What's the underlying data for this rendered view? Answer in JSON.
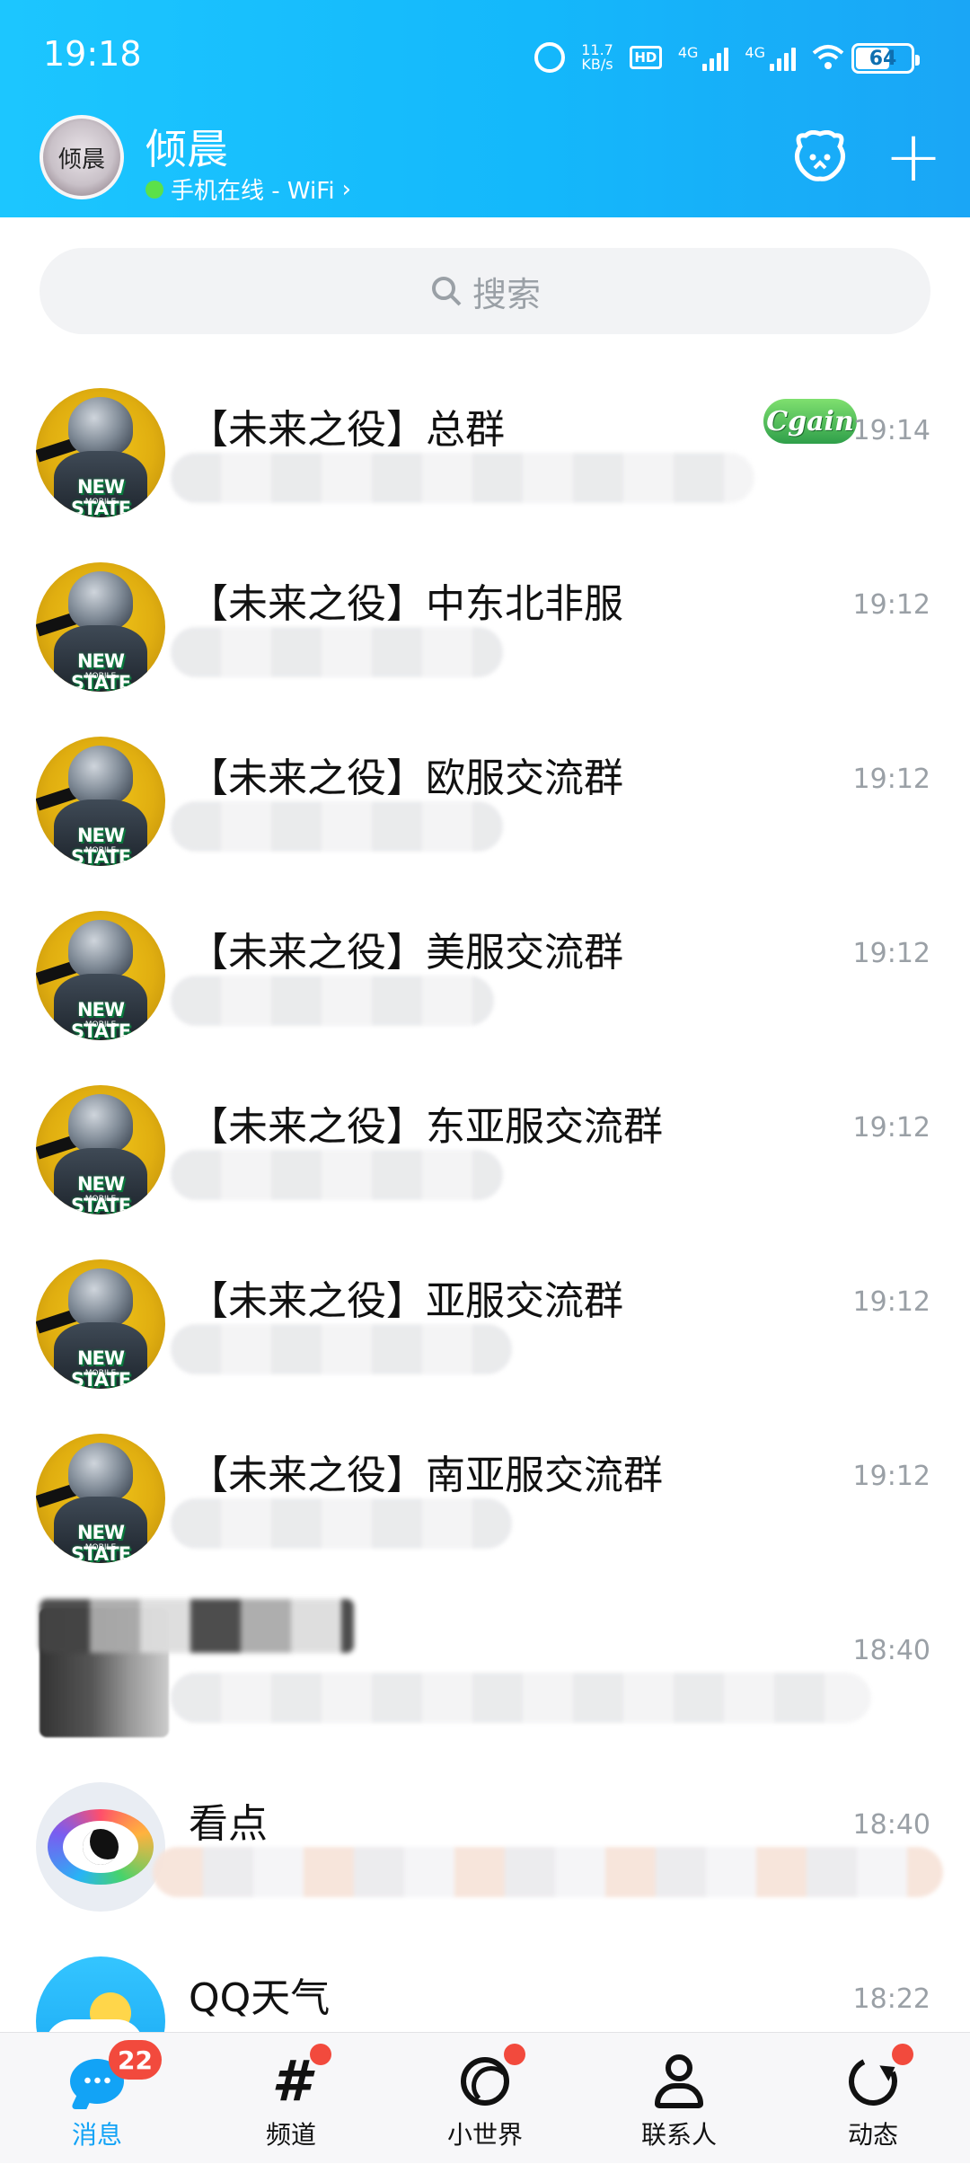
{
  "status_bar": {
    "time": "19:18",
    "net_speed_value": "11.7",
    "net_speed_unit": "KB/s",
    "hd_label": "HD",
    "signal1_label": "4G",
    "signal2_label": "4G",
    "battery": "64"
  },
  "header": {
    "avatar_text": "倾晨",
    "nickname": "倾晨",
    "online_status": "手机在线 - WiFi",
    "online_chevron": "›",
    "plus_label": "+"
  },
  "search": {
    "placeholder": "搜索",
    "icon": "search-icon"
  },
  "conversations": [
    {
      "title": "【未来之役】总群",
      "time": "19:14",
      "badge": "Cgain",
      "avatar_logo": "NEW STATE",
      "avatar_sub": "MOBILE"
    },
    {
      "title": "【未来之役】中东北非服",
      "time": "19:12",
      "avatar_logo": "NEW STATE",
      "avatar_sub": "MOBILE"
    },
    {
      "title": "【未来之役】欧服交流群",
      "time": "19:12",
      "avatar_logo": "NEW STATE",
      "avatar_sub": "MOBILE"
    },
    {
      "title": "【未来之役】美服交流群",
      "time": "19:12",
      "avatar_logo": "NEW STATE",
      "avatar_sub": "MOBILE"
    },
    {
      "title": "【未来之役】东亚服交流群",
      "time": "19:12",
      "avatar_logo": "NEW STATE",
      "avatar_sub": "MOBILE"
    },
    {
      "title": "【未来之役】亚服交流群",
      "time": "19:12",
      "avatar_logo": "NEW STATE",
      "avatar_sub": "MOBILE"
    },
    {
      "title": "【未来之役】南亚服交流群",
      "time": "19:12",
      "avatar_logo": "NEW STATE",
      "avatar_sub": "MOBILE"
    },
    {
      "title": "",
      "time": "18:40"
    },
    {
      "title": "看点",
      "time": "18:40"
    },
    {
      "title": "QQ天气",
      "time": "18:22"
    }
  ],
  "bottom_nav": {
    "tabs": [
      {
        "label": "消息",
        "badge": "22",
        "active": true
      },
      {
        "label": "频道",
        "dot": true
      },
      {
        "label": "小世界",
        "dot": true
      },
      {
        "label": "联系人"
      },
      {
        "label": "动态",
        "dot": true
      }
    ]
  },
  "colors": {
    "header_gradient_start": "#1cc6ff",
    "header_gradient_end": "#1aa6f6",
    "accent": "#12a3f6",
    "badge_red": "#f24a3d",
    "online_green": "#5be14a"
  }
}
